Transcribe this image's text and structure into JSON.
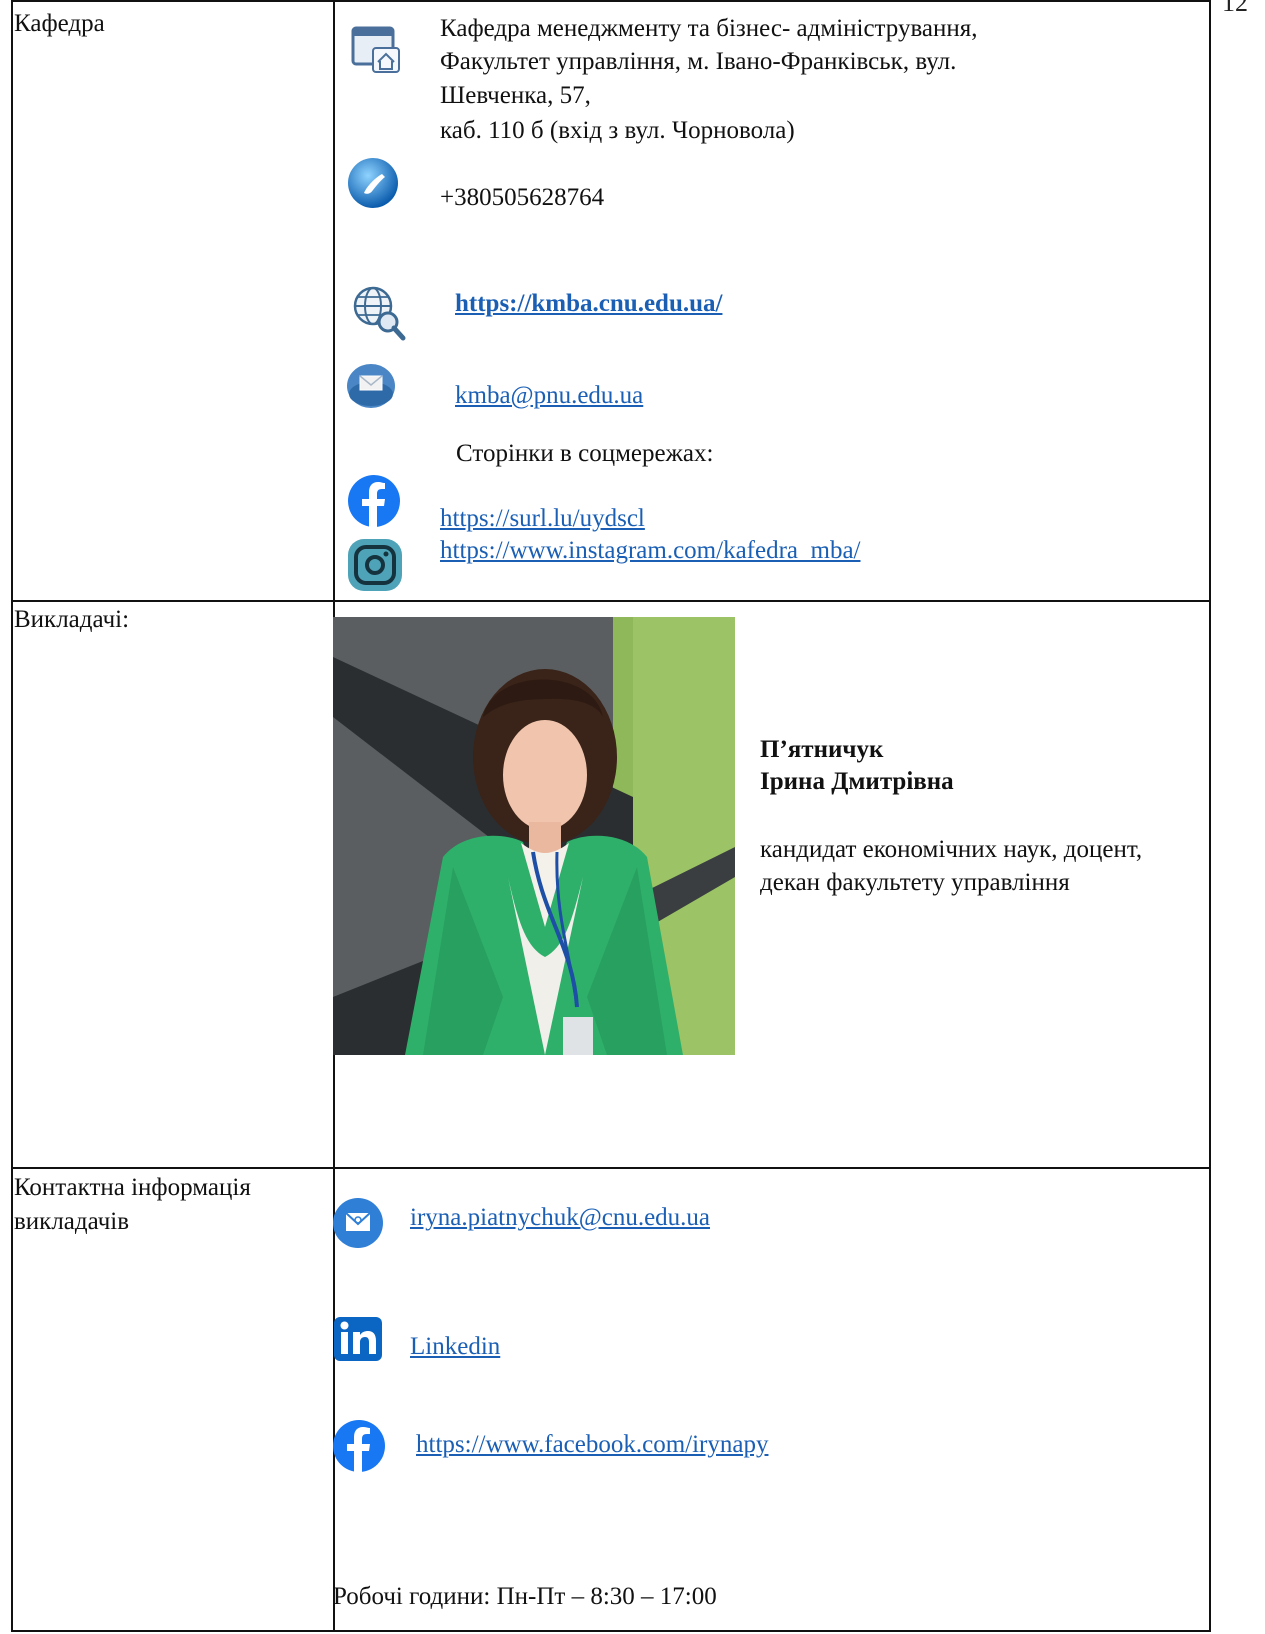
{
  "page_number": "12",
  "row1": {
    "label": "Кафедра",
    "address_lines": [
      "Кафедра менеджменту та бізнес- адміністрування,",
      "Факультет управління, м. Івано-Франківськ, вул.",
      "Шевченка, 57,",
      "каб. 110 б (вхід з вул. Чорновола)"
    ],
    "phone": "+380505628764",
    "website": "https://kmba.cnu.edu.ua/",
    "email": "kmba@pnu.edu.ua",
    "social_heading": "Сторінки в соцмережах:",
    "facebook_link": "https://surl.lu/uydscl",
    "instagram_link": "https://www.instagram.com/kafedra_mba/"
  },
  "row2": {
    "label": "Викладачі:",
    "name_line1": "П’ятничук",
    "name_line2": "Ірина Дмитрівна",
    "title_line1": "кандидат економічних наук, доцент,",
    "title_line2": "декан факультету управління"
  },
  "row3": {
    "label_line1": "Контактна інформація",
    "label_line2": "викладачів",
    "email": "iryna.piatnychuk@cnu.edu.ua",
    "linkedin": "Linkedin",
    "facebook": "https://www.facebook.com/irynapy",
    "hours": "Робочі години: Пн-Пт – 8:30 – 17:00"
  },
  "colors": {
    "link": "#1a5fb4",
    "facebook": "#1877f2",
    "linkedin": "#0a66c2",
    "jacket_green": "#2fb06a"
  }
}
